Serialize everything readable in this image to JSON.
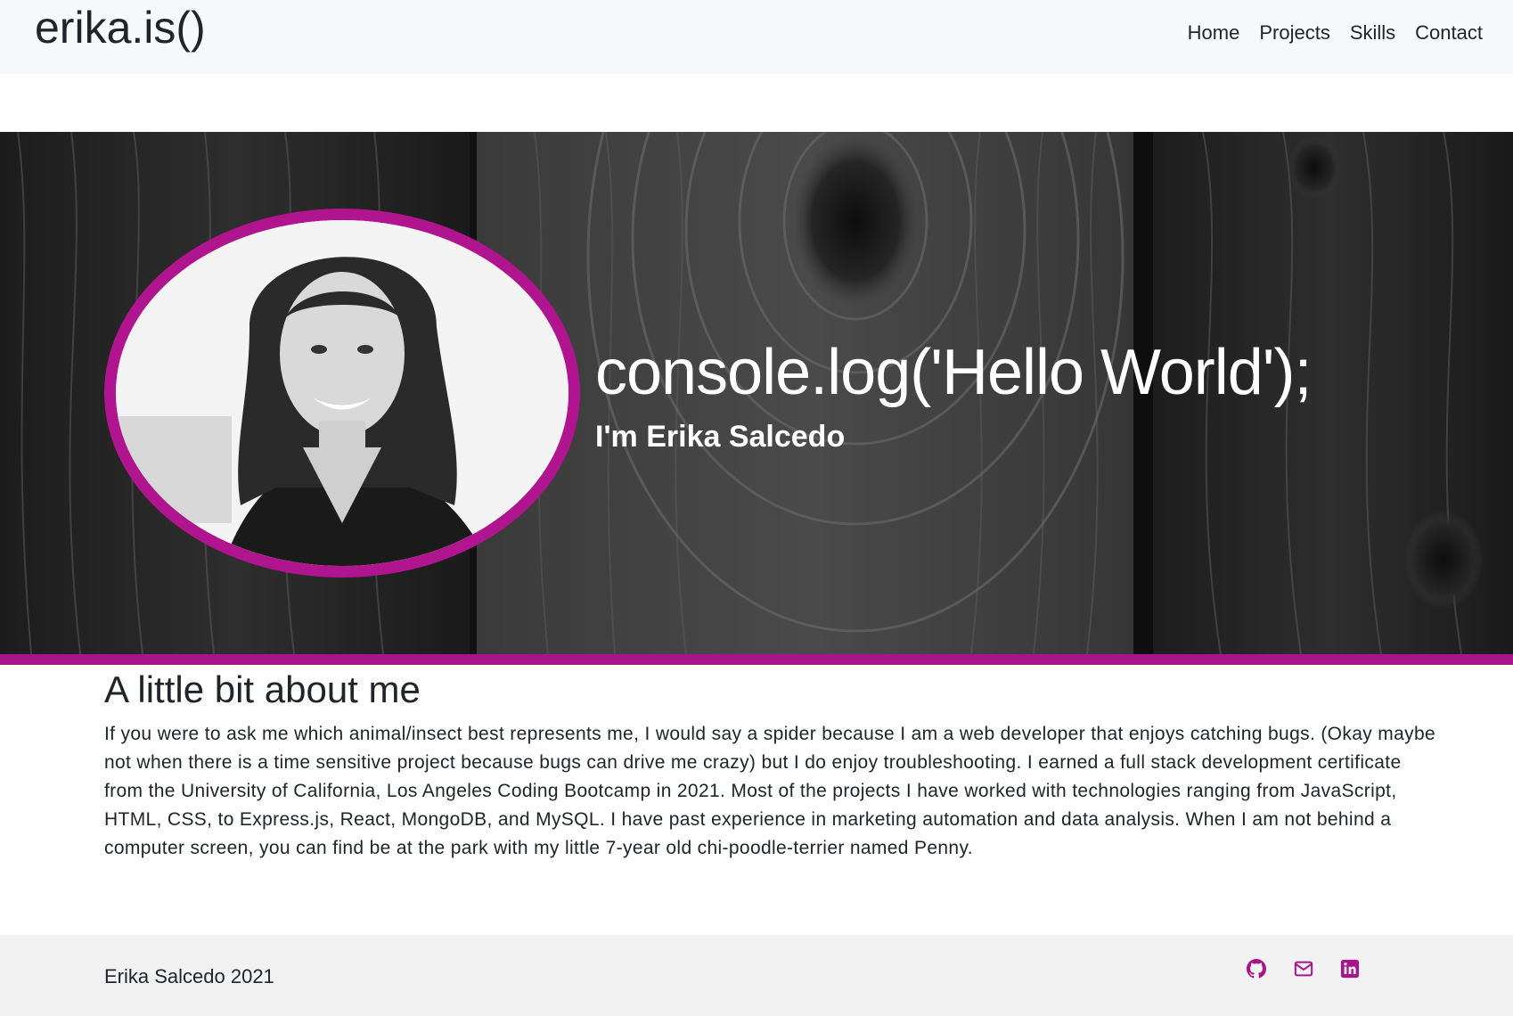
{
  "navbar": {
    "brand": "erika.is()",
    "links": [
      {
        "label": "Home"
      },
      {
        "label": "Projects"
      },
      {
        "label": "Skills"
      },
      {
        "label": "Contact"
      }
    ]
  },
  "hero": {
    "title": "console.log('Hello World');",
    "subtitle": "I'm Erika Salcedo",
    "accent_color": "#a8158a"
  },
  "about": {
    "heading": "A little bit about me",
    "body": "If you were to ask me which animal/insect best represents me, I would say a spider because I am a web developer that enjoys catching bugs. (Okay maybe not when there is a time sensitive project because bugs can drive me crazy) but I do enjoy troubleshooting. I earned a full stack development certificate from the University of California, Los Angeles Coding Bootcamp in 2021. Most of the projects I have worked with technologies ranging from JavaScript, HTML, CSS, to Express.js, React, MongoDB, and MySQL. I have past experience in marketing automation and data analysis. When I am not behind a computer screen, you can find be at the park with my little 7-year old chi-poodle-terrier named Penny."
  },
  "footer": {
    "text": "Erika Salcedo 2021",
    "icons": [
      "github-icon",
      "envelope-icon",
      "linkedin-icon"
    ],
    "icon_color": "#a8158a"
  }
}
